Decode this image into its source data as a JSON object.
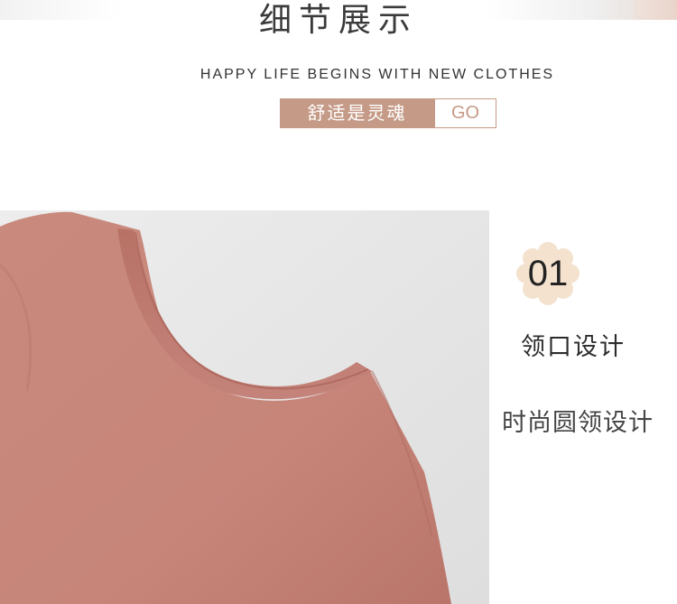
{
  "header": {
    "title": "细节展示",
    "subtitle": "HAPPY LIFE BEGINS WITH NEW CLOTHES",
    "badge_label": "舒适是灵魂",
    "badge_link": "GO"
  },
  "feature": {
    "number": "01",
    "title": "领口设计",
    "description": "时尚圆领设计"
  },
  "colors": {
    "accent": "#c59a86",
    "fabric": "#c8877a",
    "flower": "#f4e2cf"
  },
  "icons": {
    "number_badge": "flower-icon"
  }
}
